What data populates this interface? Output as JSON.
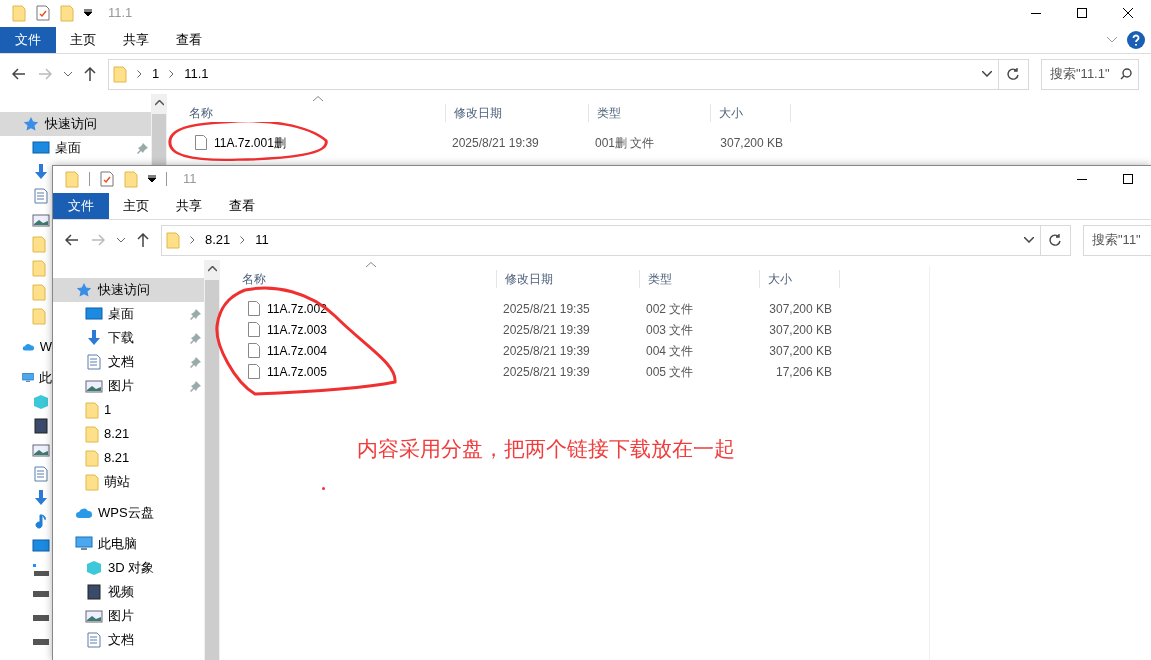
{
  "back_window": {
    "title": "11.1",
    "ribbon_tabs": [
      {
        "label": "文件",
        "kind": "menu"
      },
      {
        "label": "主页",
        "kind": "tab"
      },
      {
        "label": "共享",
        "kind": "tab"
      },
      {
        "label": "查看",
        "kind": "tab"
      }
    ],
    "path": [
      "1",
      "11.1"
    ],
    "search": {
      "placeholder": "搜索\"11.1\""
    },
    "sidebar": [
      {
        "kind": "quick",
        "label": "快速访问",
        "selected": true,
        "pinned": false,
        "children": [
          {
            "kind": "desktop",
            "label": "桌面",
            "selected": false,
            "pinned": true
          },
          {
            "kind": "download",
            "selected": false
          },
          {
            "kind": "document",
            "selected": false
          },
          {
            "kind": "picture",
            "selected": false
          },
          {
            "kind": "folder",
            "selected": false
          },
          {
            "kind": "folder",
            "selected": false
          },
          {
            "kind": "folder",
            "selected": false
          },
          {
            "kind": "folder",
            "selected": false
          }
        ]
      },
      {
        "kind": "cloud",
        "label": "W",
        "selected": false
      },
      {
        "kind": "pc",
        "label": "此",
        "selected": false,
        "children": [
          {
            "kind": "cube",
            "selected": false
          },
          {
            "kind": "video",
            "selected": false
          },
          {
            "kind": "picture",
            "selected": false
          },
          {
            "kind": "document",
            "selected": false
          },
          {
            "kind": "download",
            "selected": false
          },
          {
            "kind": "music",
            "selected": false
          },
          {
            "kind": "desktop",
            "selected": false
          },
          {
            "kind": "drive_os",
            "selected": false
          },
          {
            "kind": "drive",
            "selected": false
          },
          {
            "kind": "drive",
            "selected": false
          },
          {
            "kind": "drive",
            "selected": false
          }
        ]
      }
    ],
    "columns": [
      "名称",
      "修改日期",
      "类型",
      "大小"
    ],
    "files": [
      {
        "name": "11A.7z.001删",
        "modified": "2025/8/21 19:39",
        "type": "001删 文件",
        "size": "307,200 KB"
      }
    ]
  },
  "front_window": {
    "title": "11",
    "ribbon_tabs": [
      {
        "label": "文件",
        "kind": "menu"
      },
      {
        "label": "主页",
        "kind": "tab"
      },
      {
        "label": "共享",
        "kind": "tab"
      },
      {
        "label": "查看",
        "kind": "tab"
      }
    ],
    "path": [
      "8.21",
      "11"
    ],
    "search": {
      "placeholder": "搜索\"11\""
    },
    "sidebar": [
      {
        "kind": "quick",
        "label": "快速访问",
        "selected": true,
        "pinned": false,
        "children": [
          {
            "kind": "desktop",
            "label": "桌面",
            "selected": false,
            "pinned": true
          },
          {
            "kind": "download",
            "label": "下载",
            "selected": false,
            "pinned": true
          },
          {
            "kind": "document",
            "label": "文档",
            "selected": false,
            "pinned": true
          },
          {
            "kind": "picture",
            "label": "图片",
            "selected": false,
            "pinned": true
          },
          {
            "kind": "folder",
            "label": "1",
            "selected": false,
            "pinned": false
          },
          {
            "kind": "folder",
            "label": "8.21",
            "selected": false,
            "pinned": false
          },
          {
            "kind": "folder",
            "label": "8.21",
            "selected": false,
            "pinned": false
          },
          {
            "kind": "folder",
            "label": "萌站",
            "selected": false,
            "pinned": false
          }
        ]
      },
      {
        "kind": "cloud",
        "label": "WPS云盘",
        "selected": false,
        "pinned": false
      },
      {
        "kind": "pc",
        "label": "此电脑",
        "selected": false,
        "pinned": false,
        "children": [
          {
            "kind": "cube",
            "label": "3D 对象",
            "selected": false,
            "pinned": false
          },
          {
            "kind": "video",
            "label": "视频",
            "selected": false,
            "pinned": false
          },
          {
            "kind": "picture",
            "label": "图片",
            "selected": false,
            "pinned": false
          },
          {
            "kind": "document",
            "label": "文档",
            "selected": false,
            "pinned": false
          }
        ]
      }
    ],
    "columns": [
      "名称",
      "修改日期",
      "类型",
      "大小"
    ],
    "files": [
      {
        "name": "11A.7z.002",
        "modified": "2025/8/21 19:35",
        "type": "002 文件",
        "size": "307,200 KB"
      },
      {
        "name": "11A.7z.003",
        "modified": "2025/8/21 19:39",
        "type": "003 文件",
        "size": "307,200 KB"
      },
      {
        "name": "11A.7z.004",
        "modified": "2025/8/21 19:39",
        "type": "004 文件",
        "size": "307,200 KB"
      },
      {
        "name": "11A.7z.005",
        "modified": "2025/8/21 19:39",
        "type": "005 文件",
        "size": "17,206 KB"
      }
    ]
  },
  "annotation": {
    "text": "内容采用分盘，把两个链接下载放在一起"
  }
}
